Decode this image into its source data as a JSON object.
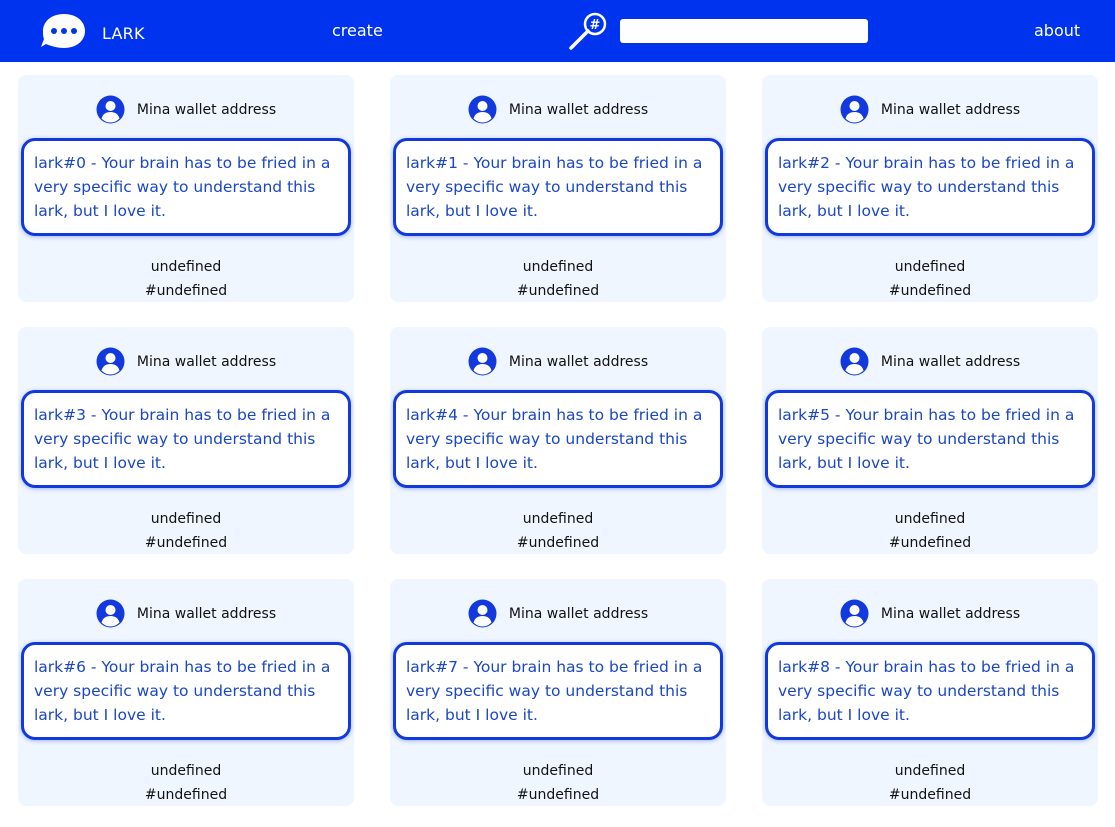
{
  "colors": {
    "nav_bg": "#0033ee",
    "card_bg": "#eff6ff",
    "accent": "#1139dd",
    "message_text": "#1a46c8"
  },
  "nav": {
    "brand_title": "LARK",
    "create_label": "create",
    "about_label": "about",
    "search_icon": "hashtag-magnifier-icon",
    "search_placeholder": "",
    "search_value": ""
  },
  "cards": [
    {
      "wallet": "Mina wallet address",
      "message": "lark#0 - Your brain has to be fried in a very specific way to understand this lark, but I love it.",
      "status": "undefined",
      "tag": "#undefined"
    },
    {
      "wallet": "Mina wallet address",
      "message": "lark#1 - Your brain has to be fried in a very specific way to understand this lark, but I love it.",
      "status": "undefined",
      "tag": "#undefined"
    },
    {
      "wallet": "Mina wallet address",
      "message": "lark#2 - Your brain has to be fried in a very specific way to understand this lark, but I love it.",
      "status": "undefined",
      "tag": "#undefined"
    },
    {
      "wallet": "Mina wallet address",
      "message": "lark#3 - Your brain has to be fried in a very specific way to understand this lark, but I love it.",
      "status": "undefined",
      "tag": "#undefined"
    },
    {
      "wallet": "Mina wallet address",
      "message": "lark#4 - Your brain has to be fried in a very specific way to understand this lark, but I love it.",
      "status": "undefined",
      "tag": "#undefined"
    },
    {
      "wallet": "Mina wallet address",
      "message": "lark#5 - Your brain has to be fried in a very specific way to understand this lark, but I love it.",
      "status": "undefined",
      "tag": "#undefined"
    },
    {
      "wallet": "Mina wallet address",
      "message": "lark#6 - Your brain has to be fried in a very specific way to understand this lark, but I love it.",
      "status": "undefined",
      "tag": "#undefined"
    },
    {
      "wallet": "Mina wallet address",
      "message": "lark#7 - Your brain has to be fried in a very specific way to understand this lark, but I love it.",
      "status": "undefined",
      "tag": "#undefined"
    },
    {
      "wallet": "Mina wallet address",
      "message": "lark#8 - Your brain has to be fried in a very specific way to understand this lark, but I love it.",
      "status": "undefined",
      "tag": "#undefined"
    }
  ]
}
